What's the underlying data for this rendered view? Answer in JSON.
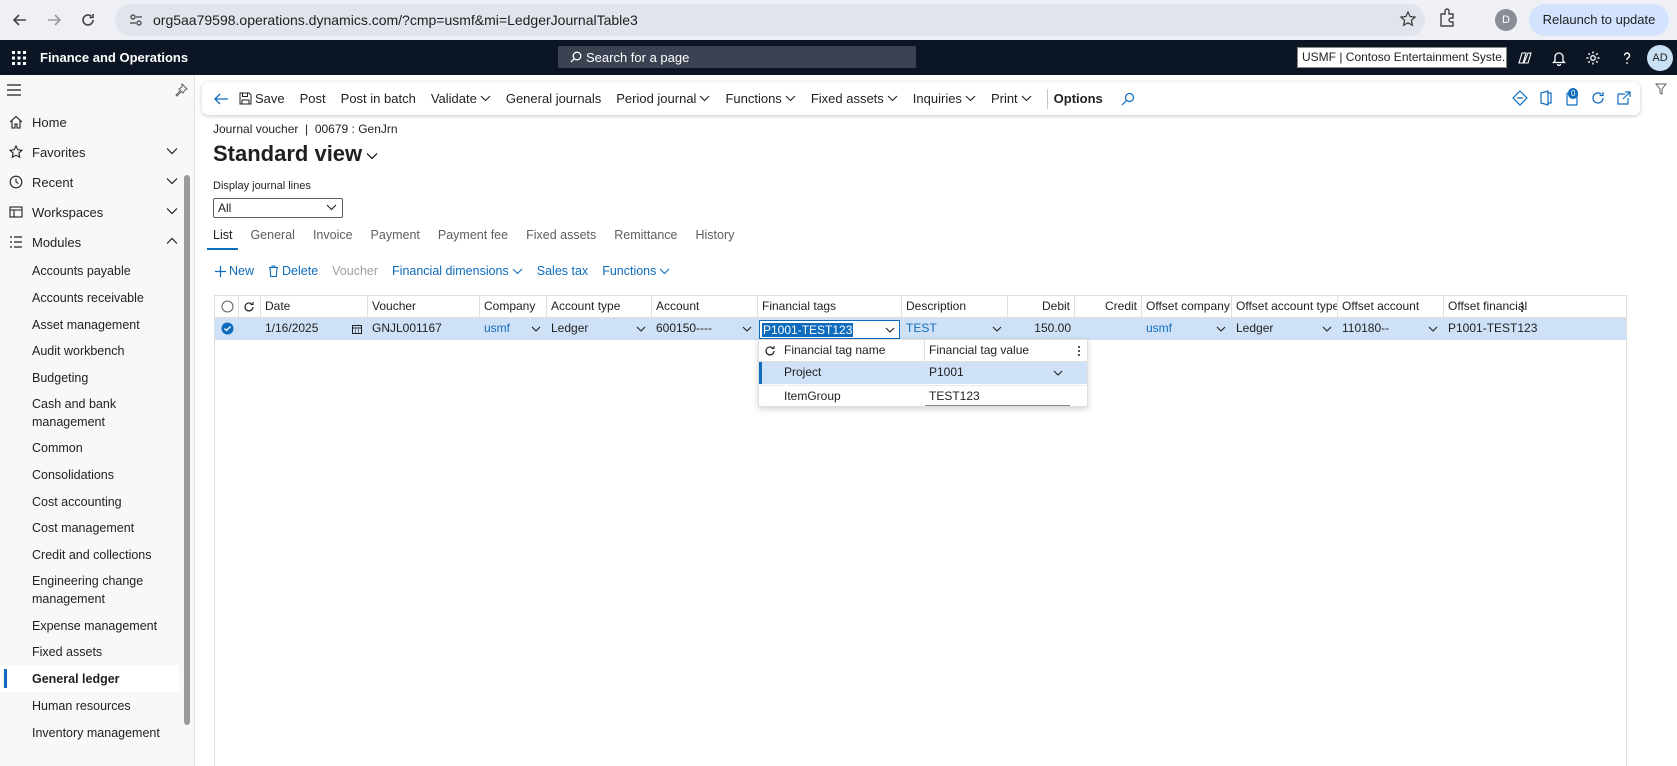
{
  "browser": {
    "url": "org5aa79598.operations.dynamics.com/?cmp=usmf&mi=LedgerJournalTable3",
    "profile_initial": "D",
    "relaunch_label": "Relaunch to update"
  },
  "app": {
    "name": "Finance and Operations",
    "search_placeholder": "Search for a page",
    "company": "USMF | Contoso Entertainment Syste...",
    "user_initials": "AD",
    "notification_count": "0"
  },
  "sidebar": {
    "nav": [
      {
        "label": "Home"
      },
      {
        "label": "Favorites"
      },
      {
        "label": "Recent"
      },
      {
        "label": "Workspaces"
      },
      {
        "label": "Modules"
      }
    ],
    "modules": [
      "Accounts payable",
      "Accounts receivable",
      "Asset management",
      "Audit workbench",
      "Budgeting",
      "Cash and bank management",
      "Common",
      "Consolidations",
      "Cost accounting",
      "Cost management",
      "Credit and collections",
      "Engineering change management",
      "Expense management",
      "Fixed assets",
      "General ledger",
      "Human resources",
      "Inventory management"
    ],
    "selected_module": "General ledger"
  },
  "actionpane": {
    "save": "Save",
    "post": "Post",
    "post_batch": "Post in batch",
    "validate": "Validate",
    "general_journals": "General journals",
    "period_journal": "Period journal",
    "functions": "Functions",
    "fixed_assets": "Fixed assets",
    "inquiries": "Inquiries",
    "print": "Print",
    "options": "Options"
  },
  "page": {
    "breadcrumb": "Journal voucher  |  00679 : GenJrn",
    "title": "Standard view",
    "display_label": "Display journal lines",
    "display_value": "All",
    "tabs": [
      "List",
      "General",
      "Invoice",
      "Payment",
      "Payment fee",
      "Fixed assets",
      "Remittance",
      "History"
    ]
  },
  "gridbar": {
    "new": "New",
    "delete": "Delete",
    "voucher": "Voucher",
    "financial_dimensions": "Financial dimensions",
    "sales_tax": "Sales tax",
    "functions": "Functions"
  },
  "grid": {
    "headers": {
      "date": "Date",
      "voucher": "Voucher",
      "company": "Company",
      "account_type": "Account type",
      "account": "Account",
      "financial_tags": "Financial tags",
      "description": "Description",
      "debit": "Debit",
      "credit": "Credit",
      "offset_company": "Offset company",
      "offset_account_type": "Offset account type",
      "offset_account": "Offset account",
      "offset_financial": "Offset financial"
    },
    "row": {
      "date": "1/16/2025",
      "voucher": "GNJL001167",
      "company": "usmf",
      "account_type": "Ledger",
      "account": "600150----",
      "financial_tags": "P1001-TEST123",
      "description": "TEST",
      "debit": "150.00",
      "credit": "",
      "offset_company": "usmf",
      "offset_account_type": "Ledger",
      "offset_account": "110180--",
      "offset_financial": "P1001-TEST123"
    }
  },
  "tag_popup": {
    "col_name": "Financial tag name",
    "col_value": "Financial tag value",
    "rows": [
      {
        "name": "Project",
        "value": "P1001"
      },
      {
        "name": "ItemGroup",
        "value": "TEST123"
      }
    ]
  }
}
